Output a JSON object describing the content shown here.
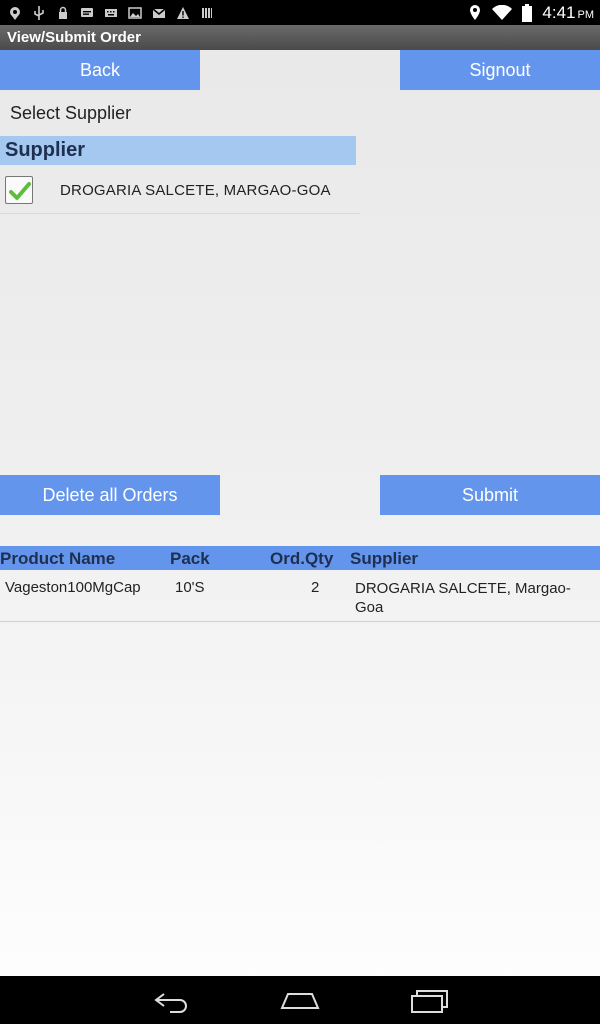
{
  "status_bar": {
    "time": "4:41",
    "ampm": "PM",
    "left_icons": [
      "location-icon",
      "usb-icon",
      "lock-icon",
      "chat-icon",
      "keyboard-icon",
      "image-icon",
      "gmail-icon",
      "warning-icon",
      "barcode-icon"
    ],
    "right_icons": [
      "location-pin-icon",
      "wifi-icon",
      "battery-icon"
    ]
  },
  "app": {
    "title": "View/Submit Order"
  },
  "top_buttons": {
    "back_label": "Back",
    "signout_label": "Signout"
  },
  "supplier_section": {
    "select_label": "Select Supplier",
    "header": "Supplier",
    "items": [
      {
        "name": "DROGARIA SALCETE, MARGAO-GOA",
        "checked": true
      }
    ]
  },
  "action_buttons": {
    "delete_label": "Delete all Orders",
    "submit_label": "Submit"
  },
  "orders_table": {
    "columns": [
      "Product Name",
      "Pack",
      "Ord.Qty",
      "Supplier"
    ],
    "rows": [
      {
        "product": "Vageston100MgCap",
        "pack": "10'S",
        "qty": "2",
        "supplier": "DROGARIA SALCETE, Margao-Goa"
      }
    ]
  },
  "colors": {
    "button": "#6495ed",
    "supplier_header": "#a4c8f0",
    "title_bar": "#555555"
  }
}
